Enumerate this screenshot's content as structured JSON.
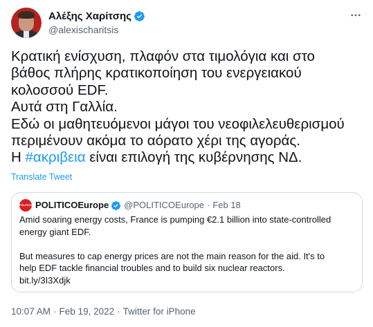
{
  "author": {
    "display_name": "Αλέξης Χαρίτσης",
    "handle": "@alexischaritsis",
    "verified_icon": "verified-badge-icon",
    "avatar": "profile-photo"
  },
  "tweet": {
    "lines": [
      "Κρατική ενίσχυση, πλαφόν στα τιμολόγια και στο",
      "βάθος πλήρης κρατικοποίηση του ενεργειακού",
      "κολοσσού EDF.",
      "Αυτά στη Γαλλία.",
      "Εδώ οι μαθητευόμενοι μάγοι του νεοφιλελευθερισμού",
      "περιμένουν ακόμα το αόρατο χέρι της αγοράς."
    ],
    "last_line_prefix": "Η ",
    "hashtag": "#ακριβεια",
    "last_line_suffix": " είναι επιλογή της κυβέρνησης ΝΔ.",
    "translate_label": "Translate Tweet"
  },
  "quote": {
    "avatar_label": "POLITICO",
    "display_name": "POLITICOEurope",
    "handle": "@POLITICOEurope",
    "separator": "·",
    "date": "Feb 18",
    "paragraph1": [
      "Amid soaring energy costs, France is pumping €2.1 billion into state-controlled",
      "energy giant EDF."
    ],
    "paragraph2": [
      "But measures to cap energy prices are not the main reason for the aid. It's to",
      "help EDF tackle financial troubles and to build six nuclear reactors.",
      "bit.ly/3I3Xdjk"
    ]
  },
  "meta": {
    "time": "10:07 AM",
    "separator": "·",
    "date": "Feb 19, 2022",
    "source": "Twitter for iPhone"
  },
  "colors": {
    "accent": "#1d9bf0",
    "secondary_text": "#536471",
    "border": "#cfd9de",
    "politico_red": "#dc1f26"
  }
}
